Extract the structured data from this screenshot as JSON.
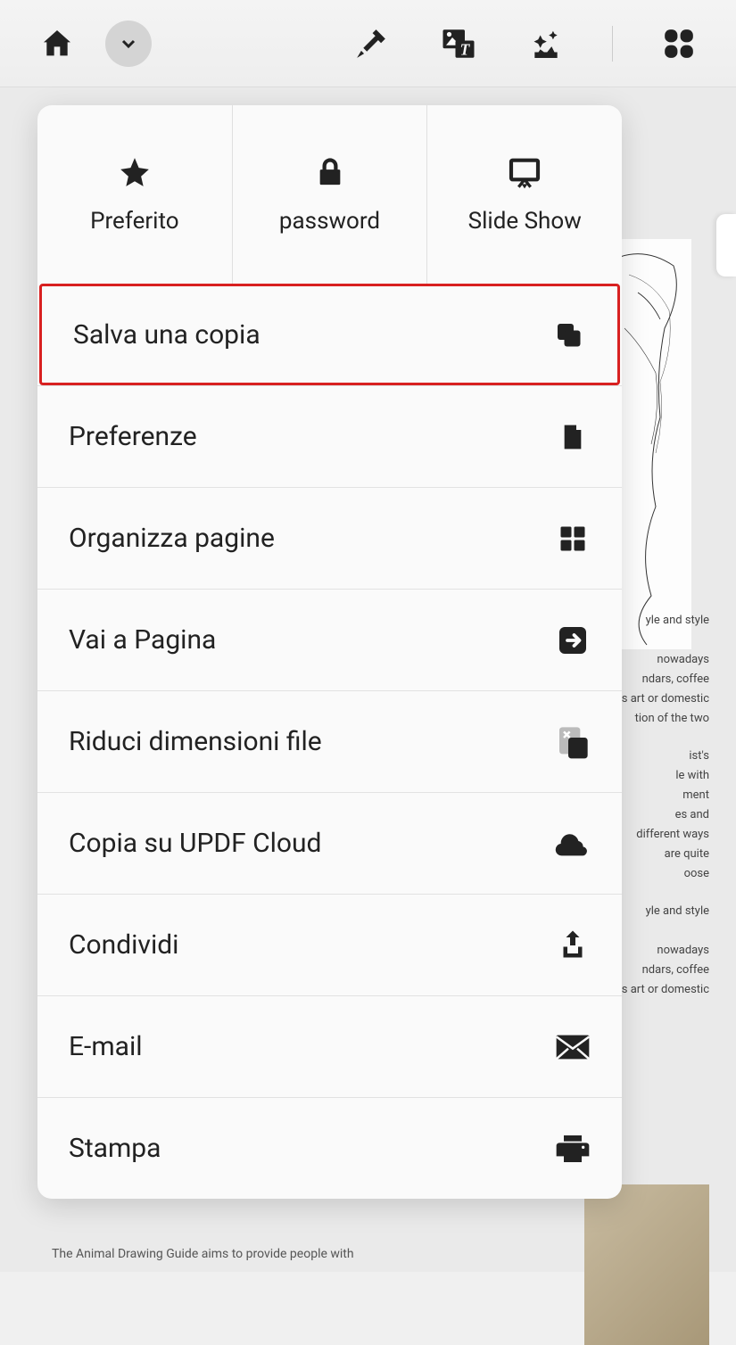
{
  "toolbar": {
    "home": "home",
    "chevron": "chevron-down",
    "highlighter": "highlighter",
    "image_text": "image-text",
    "magic": "magic-wand",
    "grid": "grid"
  },
  "dropdown": {
    "tabs": [
      {
        "label": "Preferito",
        "icon": "star"
      },
      {
        "label": "password",
        "icon": "lock"
      },
      {
        "label": "Slide Show",
        "icon": "presentation"
      }
    ],
    "items": [
      {
        "label": "Salva una copia",
        "icon": "copy",
        "highlighted": true
      },
      {
        "label": "Preferenze",
        "icon": "document"
      },
      {
        "label": "Organizza pagine",
        "icon": "grid-small"
      },
      {
        "label": "Vai a Pagina",
        "icon": "arrow-right-box"
      },
      {
        "label": "Riduci dimensioni file",
        "icon": "compress"
      },
      {
        "label": "Copia su UPDF Cloud",
        "icon": "cloud"
      },
      {
        "label": "Condividi",
        "icon": "share"
      },
      {
        "label": "E-mail",
        "icon": "mail"
      },
      {
        "label": "Stampa",
        "icon": "print"
      }
    ]
  },
  "doc_text_fragments": [
    "yle and style",
    "nowadays",
    "ndars, coffee",
    "s art or domestic",
    "tion of the two",
    "ist's",
    "le with",
    "ment",
    "es and",
    "different ways",
    "are quite",
    "oose",
    "yle and style",
    "nowadays",
    "ndars, coffee",
    "s art or domestic"
  ],
  "footer_text": "The Animal Drawing Guide aims to provide people with"
}
